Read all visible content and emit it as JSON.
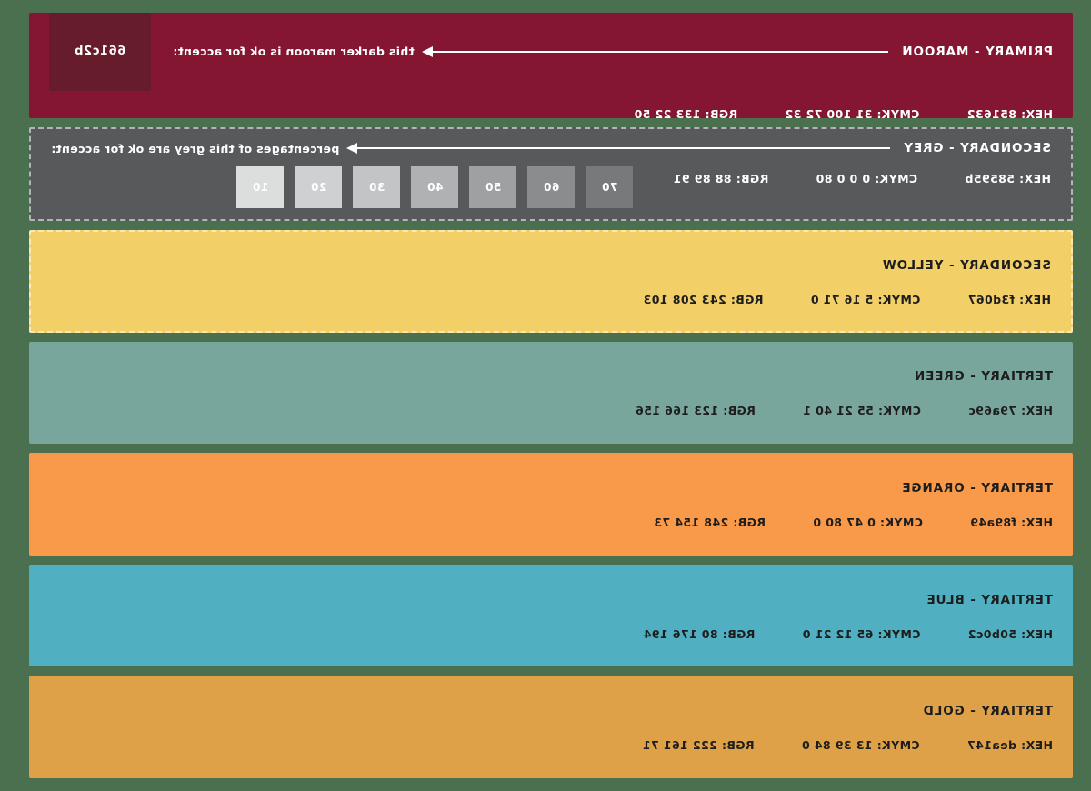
{
  "page": {
    "background_color": "#4a7050",
    "mirrored": true
  },
  "bands": [
    {
      "id": "primary-maroon",
      "title": "PRIMARY - MAROON",
      "bg": "#851632",
      "text_color": "#ffffff",
      "hex_label": "HEX: 851632",
      "cmyk_label": "CMYK: 31 100 72 32",
      "rgb_label": "RGB: 133 22 50",
      "note": "this darker maroon is ok for accent:",
      "accent_swatch": {
        "label": "661c2b",
        "color": "#661c2b"
      }
    },
    {
      "id": "secondary-grey",
      "title": "SECONDARY - GREY",
      "bg": "#58595b",
      "text_color": "#ffffff",
      "hex_label": "HEX: 58595b",
      "cmyk_label": "CMYK: 0 0 0 80",
      "rgb_label": "RGB: 88 89 91",
      "note": "percentages of this grey are ok for accent:",
      "percent_chips": [
        {
          "label": "10",
          "color": "#dcdddd"
        },
        {
          "label": "20",
          "color": "#cfd0d1"
        },
        {
          "label": "30",
          "color": "#c3c4c5"
        },
        {
          "label": "40",
          "color": "#b0b1b3"
        },
        {
          "label": "50",
          "color": "#9fa0a2"
        },
        {
          "label": "60",
          "color": "#8b8c8e"
        },
        {
          "label": "70",
          "color": "#77797b"
        }
      ]
    },
    {
      "id": "secondary-yellow",
      "title": "SECONDARY - YELLOW",
      "bg": "#f3d067",
      "text_color": "#1d1d1d",
      "hex_label": "HEX: f3d067",
      "cmyk_label": "CMYK: 5 16 71 0",
      "rgb_label": "RGB: 243 208 103"
    },
    {
      "id": "tertiary-green",
      "title": "TERTIARY - GREEN",
      "bg": "#79a69c",
      "text_color": "#1d1d1d",
      "hex_label": "HEX: 79a69c",
      "cmyk_label": "CMYK: 55 21 40 1",
      "rgb_label": "RGB: 123 166 156"
    },
    {
      "id": "tertiary-orange",
      "title": "TERTIARY - ORANGE",
      "bg": "#f89a49",
      "text_color": "#1d1d1d",
      "hex_label": "HEX: f89a49",
      "cmyk_label": "CMYK: 0 47 80 0",
      "rgb_label": "RGB: 248 154 73"
    },
    {
      "id": "tertiary-blue",
      "title": "TERTIARY - BLUE",
      "bg": "#50b0c2",
      "text_color": "#1d1d1d",
      "hex_label": "HEX: 50b0c2",
      "cmyk_label": "CMYK: 65 12 21 0",
      "rgb_label": "RGB: 80 176 194"
    },
    {
      "id": "tertiary-gold",
      "title": "TERTIARY - GOLD",
      "bg": "#dea147",
      "text_color": "#1d1d1d",
      "hex_label": "HEX: dea147",
      "cmyk_label": "CMYK: 13 39 84 0",
      "rgb_label": "RGB: 222 161 71"
    }
  ]
}
